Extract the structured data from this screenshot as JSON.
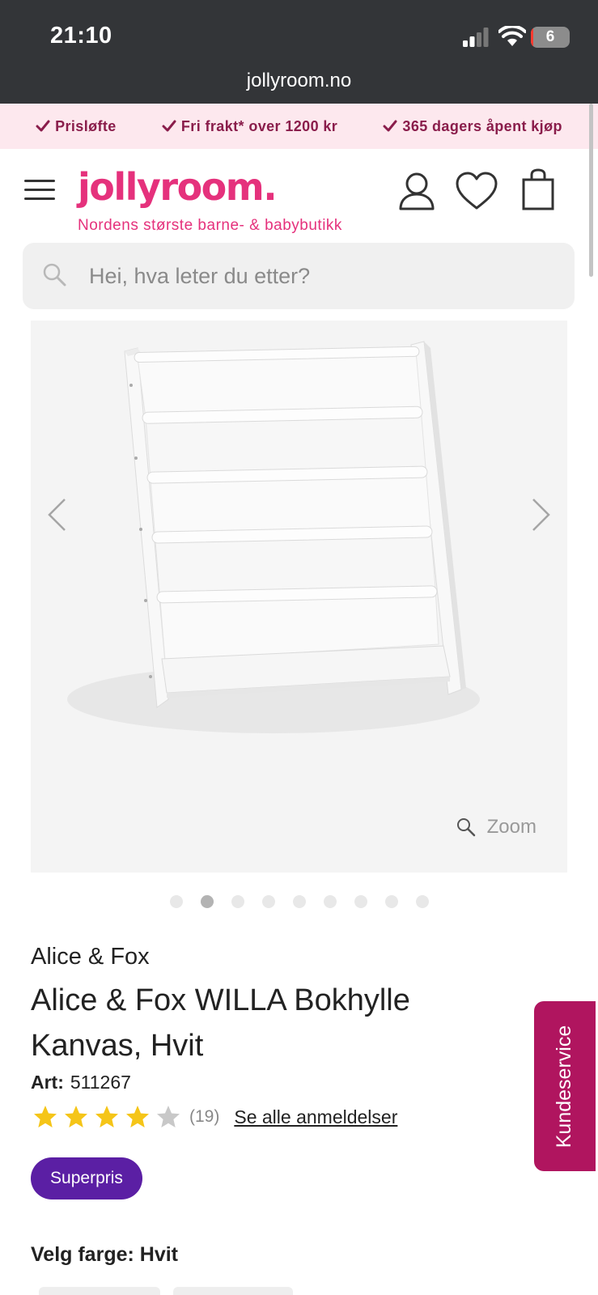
{
  "status": {
    "time": "21:10",
    "battery": "6",
    "url": "jollyroom.no"
  },
  "promo": [
    {
      "label": "Prisløfte",
      "icon": "check-icon"
    },
    {
      "label": "Fri frakt* over 1200 kr",
      "icon": "check-icon"
    },
    {
      "label": "365 dagers åpent kjøp",
      "icon": "check-icon"
    }
  ],
  "header": {
    "logo": "jollyroom.",
    "tagline": "Nordens største barne- & babybutikk"
  },
  "search": {
    "placeholder": "Hei, hva leter du etter?"
  },
  "gallery": {
    "zoom_label": "Zoom",
    "image_count": 9,
    "active_index": 1
  },
  "product": {
    "brand": "Alice & Fox",
    "title": "Alice & Fox WILLA Bokhylle Kanvas, Hvit",
    "art_label": "Art:",
    "art_number": "511267",
    "rating": 4,
    "rating_max": 5,
    "review_count": "(19)",
    "reviews_link": "Se alle anmeldelser",
    "badge": "Superpris",
    "color_label": "Velg farge:",
    "color_value": "Hvit"
  },
  "kundeservice": "Kundeservice",
  "colors": {
    "accent": "#e5317c",
    "promo_text": "#8a1d4b",
    "badge": "#5b1fa4",
    "kundeservice": "#b0155f",
    "star": "#f5c518"
  }
}
